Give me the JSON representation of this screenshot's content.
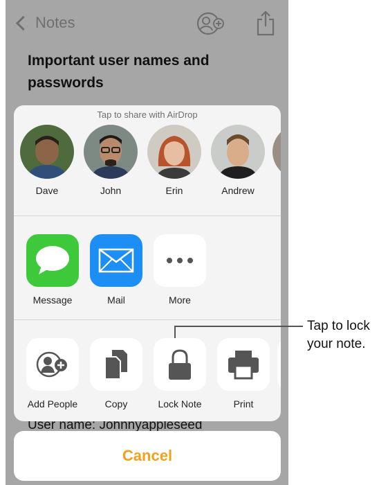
{
  "navbar": {
    "back_label": "Notes"
  },
  "note": {
    "title": "Important user names and passwords",
    "peek_text": "User name: Johnnyappleseed"
  },
  "share_sheet": {
    "airdrop_caption": "Tap to share with AirDrop",
    "people": [
      {
        "name": "Dave",
        "skin": "#8c6548",
        "hair": "#2a2019",
        "bg": "#4f6b3e"
      },
      {
        "name": "John",
        "skin": "#b98a6c",
        "hair": "#1c1a18",
        "bg": "#7d8a83"
      },
      {
        "name": "Erin",
        "skin": "#e6bfa3",
        "hair": "#b8542c",
        "bg": "#cfcac2"
      },
      {
        "name": "Andrew",
        "skin": "#d9ac8a",
        "hair": "#6b4b2e",
        "bg": "#c9ccc9"
      }
    ],
    "apps": [
      {
        "label": "Message",
        "icon": "speech-bubble-icon",
        "color": "#3ec93b"
      },
      {
        "label": "Mail",
        "icon": "envelope-icon",
        "color": "#1d8ef6"
      },
      {
        "label": "More",
        "icon": "ellipsis-icon",
        "color": "#ffffff"
      }
    ],
    "actions": [
      {
        "label": "Add People",
        "icon": "add-people-icon"
      },
      {
        "label": "Copy",
        "icon": "copy-icon"
      },
      {
        "label": "Lock Note",
        "icon": "lock-icon"
      },
      {
        "label": "Print",
        "icon": "printer-icon"
      }
    ],
    "cancel_label": "Cancel"
  },
  "callout": {
    "line1": "Tap to lock",
    "line2": "your note."
  },
  "colors": {
    "cancel_text": "#f0a21f",
    "dim_overlay": "#a6a6a6",
    "icon_gray": "#555555"
  }
}
